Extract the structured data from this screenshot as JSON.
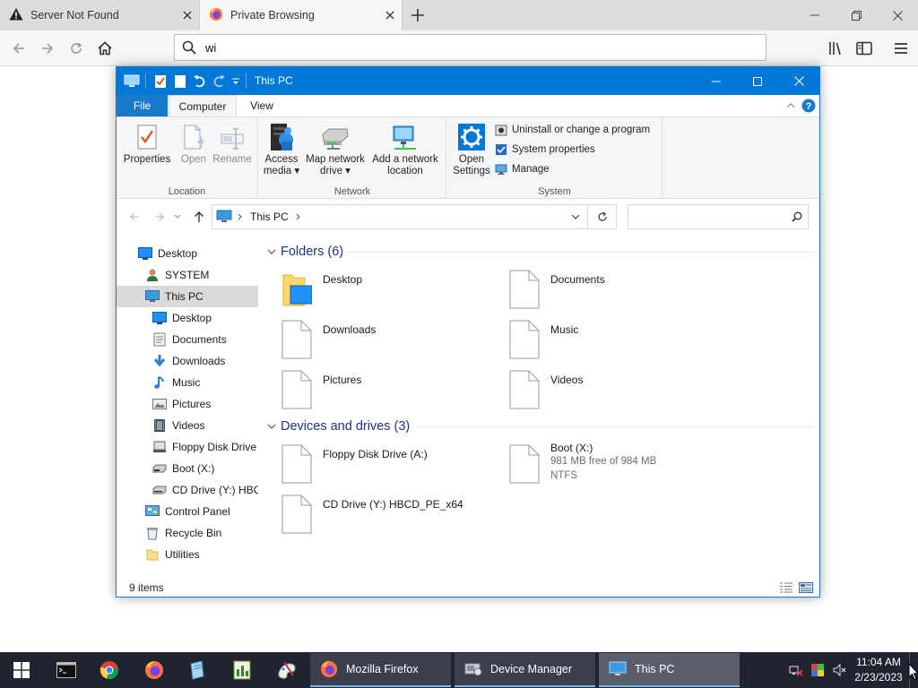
{
  "firefox": {
    "tabs": [
      {
        "title": "Server Not Found"
      },
      {
        "title": "Private Browsing"
      }
    ],
    "url_value": "wi"
  },
  "explorer": {
    "title": "This PC",
    "ribbon_tabs": [
      "File",
      "Computer",
      "View"
    ],
    "ribbon": {
      "location": {
        "label": "Location",
        "properties": "Properties",
        "open": "Open",
        "rename": "Rename"
      },
      "network": {
        "label": "Network",
        "access_media_1": "Access",
        "access_media_2": "media",
        "map_drive_1": "Map network",
        "map_drive_2": "drive",
        "add_location_1": "Add a network",
        "add_location_2": "location"
      },
      "system": {
        "label": "System",
        "open_settings_1": "Open",
        "open_settings_2": "Settings",
        "uninstall": "Uninstall or change a program",
        "system_properties": "System properties",
        "manage": "Manage"
      }
    },
    "address": {
      "crumb": "This PC"
    },
    "nav": [
      {
        "label": "Desktop",
        "icon": "desktop-icon"
      },
      {
        "label": "SYSTEM",
        "icon": "user-icon"
      },
      {
        "label": "This PC",
        "icon": "computer-icon"
      },
      {
        "label": "Desktop",
        "icon": "desktop-icon"
      },
      {
        "label": "Documents",
        "icon": "documents-icon"
      },
      {
        "label": "Downloads",
        "icon": "downloads-icon"
      },
      {
        "label": "Music",
        "icon": "music-icon"
      },
      {
        "label": "Pictures",
        "icon": "pictures-icon"
      },
      {
        "label": "Videos",
        "icon": "videos-icon"
      },
      {
        "label": "Floppy Disk Drive",
        "icon": "floppy-icon"
      },
      {
        "label": "Boot (X:)",
        "icon": "drive-icon"
      },
      {
        "label": "CD Drive (Y:) HBC",
        "icon": "cd-drive-icon"
      },
      {
        "label": "Control Panel",
        "icon": "control-panel-icon"
      },
      {
        "label": "Recycle Bin",
        "icon": "recycle-bin-icon"
      },
      {
        "label": "Utilities",
        "icon": "folder-icon"
      }
    ],
    "groups": {
      "folders": {
        "title": "Folders (6)",
        "items": [
          {
            "name": "Desktop"
          },
          {
            "name": "Documents"
          },
          {
            "name": "Downloads"
          },
          {
            "name": "Music"
          },
          {
            "name": "Pictures"
          },
          {
            "name": "Videos"
          }
        ]
      },
      "devices": {
        "title": "Devices and drives (3)",
        "items": [
          {
            "name": "Floppy Disk Drive (A:)",
            "free": "",
            "fs": ""
          },
          {
            "name": "Boot (X:)",
            "free": "981 MB free of 984 MB",
            "fs": "NTFS"
          },
          {
            "name": "CD Drive (Y:) HBCD_PE_x64",
            "free": "",
            "fs": ""
          }
        ]
      }
    },
    "status": {
      "count": "9 items"
    }
  },
  "taskbar": {
    "tasks": [
      {
        "label": "Mozilla Firefox"
      },
      {
        "label": "Device Manager"
      },
      {
        "label": "This PC"
      }
    ],
    "clock": {
      "time": "11:04 AM",
      "date": "2/23/2023"
    }
  },
  "colors": {
    "accent": "#0078d7",
    "taskbar": "#1f2430",
    "group_heading": "#1e3287"
  }
}
